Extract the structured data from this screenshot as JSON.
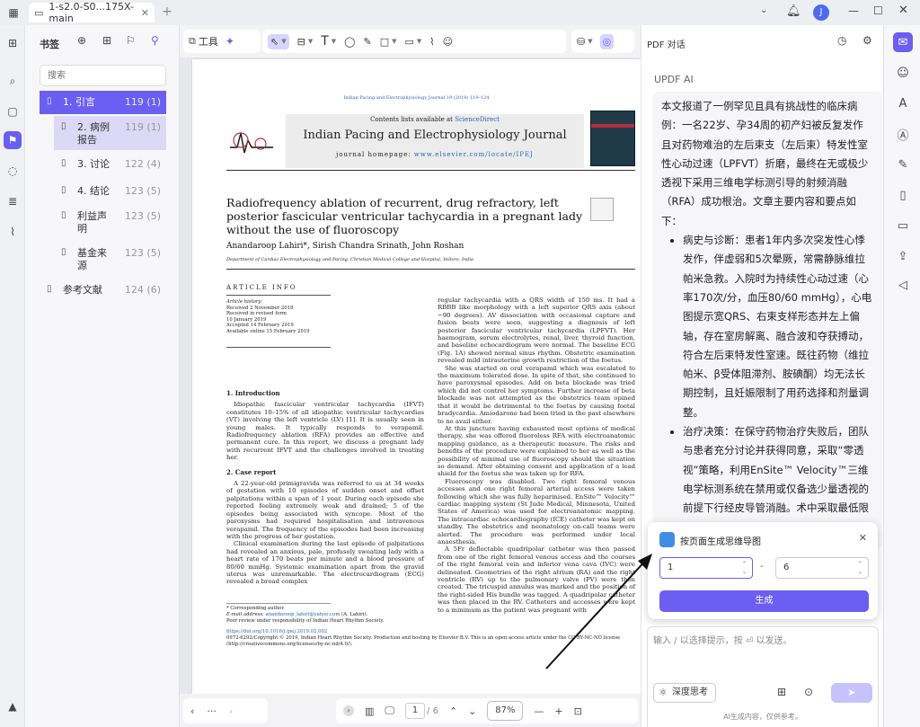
{
  "app": {
    "tab_title": "1-s2.0-S0...175X-main",
    "user_initial": "J"
  },
  "sidebar": {
    "title": "书签",
    "search_placeholder": "搜索",
    "bookmarks": [
      {
        "label": "1. 引言",
        "page": "119 (1)"
      },
      {
        "label": "2. 病例报告",
        "page": "119 (1)"
      },
      {
        "label": "3. 讨论",
        "page": "122 (4)"
      },
      {
        "label": "4. 结论",
        "page": "123 (5)"
      },
      {
        "label": "利益声明",
        "page": "123 (5)"
      },
      {
        "label": "基金来源",
        "page": "123 (5)"
      },
      {
        "label": "参考文献",
        "page": "124 (6)"
      }
    ]
  },
  "toolbar": {
    "tools_label": "工具"
  },
  "document": {
    "journal_top": "Indian Pacing and Electrophysiology Journal 19 (2019) 119–124",
    "contents_prefix": "Contents lists available at ",
    "contents_link": "ScienceDirect",
    "journal_name": "Indian Pacing and Electrophysiology Journal",
    "homepage_prefix": "journal homepage: ",
    "homepage_link": "www.elsevier.com/locate/IPEJ",
    "title": "Radiofrequency ablation of recurrent, drug refractory, left posterior fascicular ventricular tachycardia in a pregnant lady without the use of fluoroscopy",
    "authors": "Anandaroop Lahiri*, Sirish Chandra Srinath, John Roshan",
    "affiliation": "Department of Cardiac Electrophysiology and Pacing, Christian Medical College and Hospital, Vellore, India",
    "article_info": "ARTICLE INFO",
    "history": [
      "Article history:",
      "Received 2 November 2018",
      "Received in revised form",
      "10 January 2019",
      "Accepted 14 February 2019",
      "Available online 15 February 2019"
    ],
    "intro_heading": "1. Introduction",
    "intro_text": "Idiopathic fascicular ventricular tachycardia (IFVT) constitutes 10–15% of all idiopathic ventricular tachycardias (VT) involving the left ventricle (LV) [1]. It is usually seen in young males. It typically responds to verapamil. Radiofrequency ablation (RFA) provides an effective and permanent cure. In this report, we discuss a pregnant lady with recurrent IFVT and the challenges involved in treating her.",
    "case_heading": "2. Case report",
    "case_text1": "A 22-year-old primigravida was referred to us at 34 weeks of gestation with 10 episodes of sudden onset and offset palpitations within a span of 1 year. During each episode she reported feeling extremely weak and drained; 5 of the episodes being associated with syncope. Most of the paroxysms had required hospitalisation and intravenous verapamil. The frequency of the episodes had been increasing with the progress of her gestation.",
    "case_text2": "Clinical examination during the last episode of palpitations had revealed an anxious, pale, profusely sweating lady with a heart rate of 170 beats per minute and a blood pressure of 80/60 mmHg. Systemic examination apart from the gravid uterus was unremarkable. The electrocardiogram (ECG) revealed a broad complex",
    "right_p1": "regular tachycardia with a QRS width of 150 ms. It had a RBBB like morphology with a left superior QRS axis (about −90 degrees). AV dissociation with occasional capture and fusion beats were seen, suggesting a diagnosis of left posterior fascicular ventricular tachycardia (LPFVT). Her haemogram, serum electrolytes, renal, liver, thyroid function, and baseline echocardiogram were normal. The baseline ECG (Fig. 1A) showed normal sinus rhythm. Obstetric examination revealed mild intrauterine growth restriction of the foetus.",
    "right_p2": "She was started on oral verapamil which was escalated to the maximum tolerated dose. In spite of that, she continued to have paroxysmal episodes. Add on beta blockade was tried which did not control her symptoms. Further increase of beta blockade was not attempted as the obstetrics team opined that it would be detrimental to the foetus by causing foetal bradycardia. Amiodarone had been tried in the past elsewhere to no avail either.",
    "right_p3": "At this juncture having exhausted most options of medical therapy, she was offered fluoroless RFA with electroanatomic mapping guidance, as a therapeutic measure. The risks and benefits of the procedure were explained to her as well as the possibility of minimal use of fluoroscopy should the situation so demand. After obtaining consent and application of a lead shield for the foetus she was taken up for RFA.",
    "right_p4": "Fluoroscopy was disabled. Two right femoral venous accesses and one right femoral arterial access were taken following which she was fully heparinised. EnSite™ Velocity™ cardiac mapping system (St Jude Medical, Minnesota, United States of America) was used for electroanatomic mapping. The intracardiac echocardiography (ICE) catheter was kept on standby. The obstetrics and neonatology on-call teams were alerted. The procedure was performed under local anaesthesia.",
    "right_p5": "A 5Fr deflectable quadripolar catheter was then passed from one of the right femoral venous access and the courses of the right femoral vein and inferior vena cava (IVC) were delineated. Geometries of the right atrium (RA) and the right ventricle (RV) up to the pulmonary valve (PV) were then created. The tricuspid annulus was marked and the position of the right-sided His bundle was tagged. A quadripolar catheter was then placed in the RV. Catheters and accesses were kept to a minimum as the patient was pregnant with",
    "corr": "* Corresponding author.",
    "email_prefix": "E-mail address: ",
    "email": "anandaroop_lahiri@yahoo.com",
    "email_suffix": " (A. Lahiri).",
    "peer": "Peer review under responsibility of Indian Heart Rhythm Society.",
    "doi": "https://doi.org/10.1016/j.ipej.2019.02.002",
    "copyright": "0972-6292/Copyright © 2019, Indian Heart Rhythm Society. Production and hosting by Elsevier B.V. This is an open access article under the CC BY-NC-ND license (http://creativecommons.org/licenses/by-nc-nd/4.0/)."
  },
  "pager": {
    "current": "1",
    "total": "/ 6",
    "zoom": "87%"
  },
  "chat": {
    "panel_title": "PDF 对话",
    "ai_label": "UPDF AI",
    "summary_intro": "本文报道了一例罕见且具有挑战性的临床病例：一名22岁、孕34周的初产妇被反复发作且对药物难治的左后束支（左后束）特发性室性心动过速（LPFVT）折磨，最终在无或极少透视下采用三维电学标测引导的射频消融（RFA）成功根治。文章主要内容和要点如下：",
    "bullets": [
      "病史与诊断：患者1年内多次突发性心悸发作，伴虚弱和5次晕厥，常需静脉维拉帕米急救。入院时为持续性心动过速（心率170次/分，血压80/60 mmHg），心电图提示宽QRS、右束支样形态并左上偏轴，存在室房解离、融合波和夺获搏动，符合左后束特发性室速。既往药物（维拉帕米、β受体阻滞剂、胺碘酮）均无法长期控制，且妊娠限制了用药选择和剂量调整。",
      "治疗决策：在保守药物治疗失败后，团队与患者充分讨论并获得同意，采取“零透视”策略，利用EnSite™ Velocity™三维电学标测系统在禁用或仅备选少量透视的前提下行经皮导管消融。术中采取最低限度的血管通路、备有经腔内超声及产科、新生儿团队待命等产科特殊安全措施。"
    ],
    "popup": {
      "title": "按页面生成思维导图",
      "from": "1",
      "to": "6",
      "dash": "-",
      "generate": "生成"
    },
    "input_placeholder": "输入 / 以选择提示，按 ⏎ 以发送。",
    "deep_think": "深度思考",
    "send": "➤",
    "disclaimer": "AI生成内容，仅供参考。"
  }
}
